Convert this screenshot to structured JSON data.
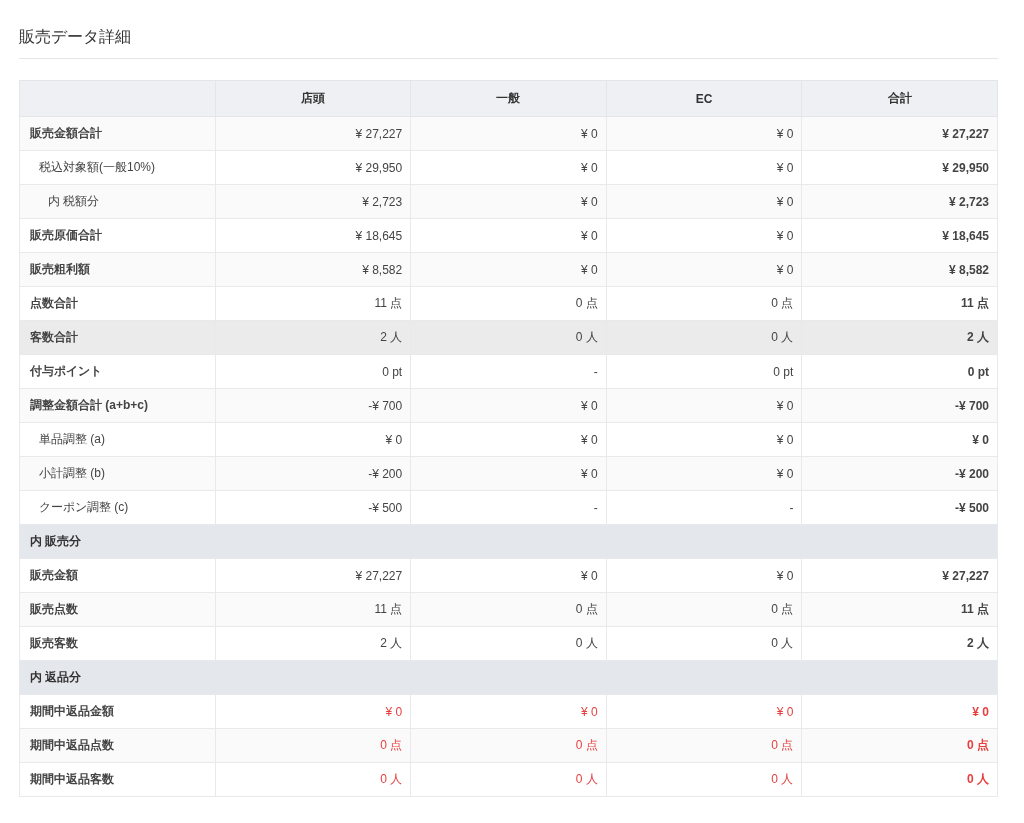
{
  "title": "販売データ詳細",
  "table": {
    "columns": [
      "",
      "店頭",
      "一般",
      "EC",
      "合計"
    ],
    "sections": [
      {
        "kind": "normal",
        "rows": [
          {
            "label": "販売金額合計",
            "hovered": false,
            "values": [
              "¥ 27,227",
              "¥ 0",
              "¥ 0",
              "¥ 27,227"
            ],
            "children": [
              {
                "label": "税込対象額(一般10%)",
                "hovered": false,
                "values": [
                  "¥ 29,950",
                  "¥ 0",
                  "¥ 0",
                  "¥ 29,950"
                ],
                "children": [
                  {
                    "label": "内 税額分",
                    "hovered": false,
                    "values": [
                      "¥ 2,723",
                      "¥ 0",
                      "¥ 0",
                      "¥ 2,723"
                    ]
                  }
                ]
              }
            ]
          },
          {
            "label": "販売原価合計",
            "hovered": false,
            "values": [
              "¥ 18,645",
              "¥ 0",
              "¥ 0",
              "¥ 18,645"
            ]
          },
          {
            "label": "販売粗利額",
            "hovered": false,
            "values": [
              "¥ 8,582",
              "¥ 0",
              "¥ 0",
              "¥ 8,582"
            ]
          },
          {
            "label": "点数合計",
            "hovered": false,
            "values": [
              "11 点",
              "0 点",
              "0 点",
              "11 点"
            ]
          },
          {
            "label": "客数合計",
            "hovered": true,
            "values": [
              "2 人",
              "0 人",
              "0 人",
              "2 人"
            ]
          },
          {
            "label": "付与ポイント",
            "hovered": false,
            "values": [
              "0 pt",
              "-",
              "0 pt",
              "0 pt"
            ]
          },
          {
            "label": "調整金額合計 (a+b+c)",
            "hovered": false,
            "values": [
              "-¥ 700",
              "¥ 0",
              "¥ 0",
              "-¥ 700"
            ],
            "children": [
              {
                "label": "単品調整 (a)",
                "hovered": false,
                "values": [
                  "¥ 0",
                  "¥ 0",
                  "¥ 0",
                  "¥ 0"
                ]
              },
              {
                "label": "小計調整 (b)",
                "hovered": false,
                "values": [
                  "-¥ 200",
                  "¥ 0",
                  "¥ 0",
                  "-¥ 200"
                ]
              },
              {
                "label": "クーポン調整 (c)",
                "hovered": false,
                "values": [
                  "-¥ 500",
                  "-",
                  "-",
                  "-¥ 500"
                ]
              }
            ]
          }
        ]
      },
      {
        "title": "内 販売分",
        "kind": "normal",
        "rows": [
          {
            "label": "販売金額",
            "hovered": false,
            "values": [
              "¥ 27,227",
              "¥ 0",
              "¥ 0",
              "¥ 27,227"
            ]
          },
          {
            "label": "販売点数",
            "hovered": false,
            "values": [
              "11 点",
              "0 点",
              "0 点",
              "11 点"
            ]
          },
          {
            "label": "販売客数",
            "hovered": false,
            "values": [
              "2 人",
              "0 人",
              "0 人",
              "2 人"
            ]
          }
        ]
      },
      {
        "title": "内 返品分",
        "kind": "return",
        "rows": [
          {
            "label": "期間中返品金額",
            "hovered": false,
            "values": [
              "¥ 0",
              "¥ 0",
              "¥ 0",
              "¥ 0"
            ]
          },
          {
            "label": "期間中返品点数",
            "hovered": false,
            "values": [
              "0 点",
              "0 点",
              "0 点",
              "0 点"
            ]
          },
          {
            "label": "期間中返品客数",
            "hovered": false,
            "values": [
              "0 人",
              "0 人",
              "0 人",
              "0 人"
            ]
          }
        ]
      }
    ]
  }
}
